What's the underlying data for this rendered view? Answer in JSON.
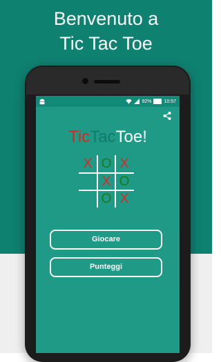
{
  "promo": {
    "line1": "Benvenuto a",
    "line2": "Tic Tac Toe"
  },
  "status_bar": {
    "battery": "92%",
    "time": "10:57"
  },
  "app": {
    "title_parts": [
      {
        "text": "Tic",
        "color": "#e02424"
      },
      {
        "text": "Tac",
        "color": "#127a6a"
      },
      {
        "text": "Toe!",
        "color": "#ffffff"
      }
    ],
    "board": [
      [
        "X",
        "O",
        "X"
      ],
      [
        "",
        "X",
        "O"
      ],
      [
        "",
        "O",
        "X"
      ]
    ],
    "colors": {
      "X": "#e02424",
      "O": "#1a7a1a"
    },
    "buttons": {
      "play": "Giocare",
      "scores": "Punteggi"
    }
  },
  "icons": [
    "android-icon",
    "wifi-icon",
    "signal-icon",
    "battery-icon",
    "share-icon"
  ]
}
